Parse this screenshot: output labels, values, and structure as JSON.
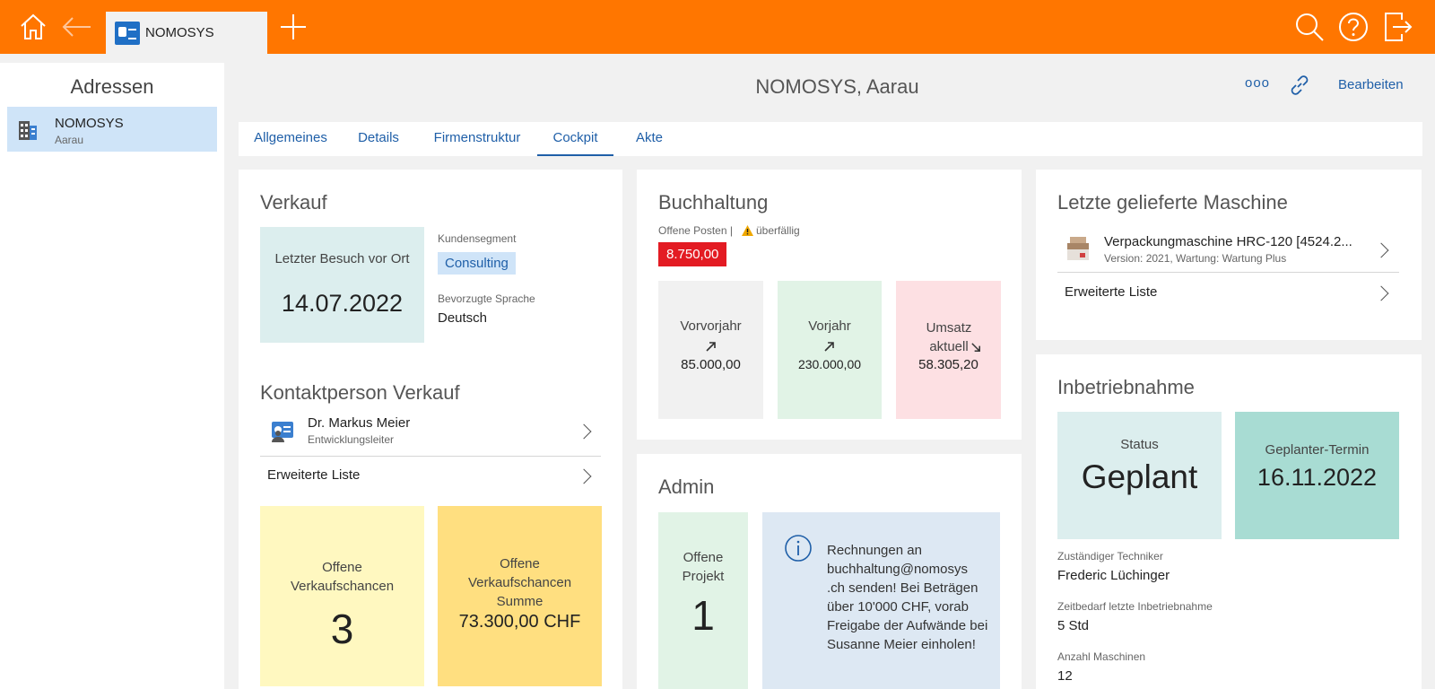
{
  "app": {
    "tab_label": "NOMOSYS",
    "icons": [
      "home-icon",
      "back-arrow-icon",
      "add-tab-icon",
      "search-icon",
      "help-icon",
      "logout-icon"
    ],
    "accent": "#ff7600",
    "link_color": "#1f5fa8"
  },
  "sidebar": {
    "title": "Adressen",
    "items": [
      {
        "name": "NOMOSYS",
        "sub": "Aarau"
      }
    ]
  },
  "header": {
    "title": "NOMOSYS, Aarau",
    "more_label": "ooo",
    "edit_label": "Bearbeiten"
  },
  "tabs": [
    {
      "label": "Allgemeines"
    },
    {
      "label": "Details"
    },
    {
      "label": "Firmenstruktur"
    },
    {
      "label": "Cockpit"
    },
    {
      "label": "Akte"
    }
  ],
  "verkauf": {
    "title": "Verkauf",
    "last_visit_label": "Letzter Besuch vor Ort",
    "last_visit_date": "14.07.2022",
    "segment_label": "Kundensegment",
    "segment_value": "Consulting",
    "lang_label": "Bevorzugte Sprache",
    "lang_value": "Deutsch",
    "contact_title": "Kontaktperson Verkauf",
    "contact_name": "Dr. Markus Meier",
    "contact_role": "Entwicklungsleiter",
    "extended_list": "Erweiterte Liste",
    "open_chances_label": "Offene Verkaufschancen",
    "open_chances_value": "3",
    "open_sum_label": "Offene Verkaufschancen Summe",
    "open_sum_value": "73.300,00 CHF"
  },
  "buchhaltung": {
    "title": "Buchhaltung",
    "open_items_label": "Offene Posten |",
    "overdue_label": "überfällig",
    "open_amount": "8.750,00",
    "prev2_label": "Vorvorjahr",
    "prev2_value": "85.000,00",
    "prev_label": "Vorjahr",
    "prev_value": "230.000,00",
    "current_label": "Umsatz aktuell",
    "current_value": "58.305,20"
  },
  "admin": {
    "title": "Admin",
    "open_projects_label": "Offene Projekt",
    "open_projects_value": "1",
    "note": "Rechnungen an buchhaltung@nomosys .ch senden! Bei Beträgen über 10'000 CHF, vorab Freigabe der Aufwände bei Susanne Meier einholen!"
  },
  "maschine": {
    "title": "Letzte gelieferte Maschine",
    "name": "Verpackungmaschine HRC-120 [4524.2...",
    "sub": "Version: 2021, Wartung: Wartung Plus",
    "extended_list": "Erweiterte Liste"
  },
  "inbetriebnahme": {
    "title": "Inbetriebnahme",
    "status_label": "Status",
    "status_value": "Geplant",
    "termin_label": "Geplanter-Termin",
    "termin_value": "16.11.2022",
    "tech_label": "Zuständiger Techniker",
    "tech_value": "Frederic Lüchinger",
    "time_label": "Zeitbedarf letzte Inbetriebnahme",
    "time_value": "5 Std",
    "count_label": "Anzahl Maschinen",
    "count_value": "12"
  }
}
